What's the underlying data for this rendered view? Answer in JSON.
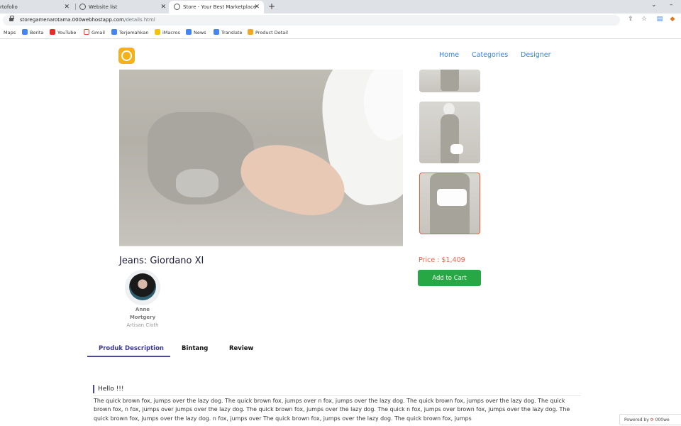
{
  "browser": {
    "tabs": [
      {
        "title": "rtofolio"
      },
      {
        "title": "Website list"
      },
      {
        "title": "Store - Your Best Marketplace"
      }
    ],
    "url_host": "storegamenarotama.000webhostapp.com",
    "url_path": "/details.html",
    "bookmarks": [
      "Maps",
      "Berita",
      "YouTube",
      "Gmail",
      "Terjemahkan",
      "iMacros",
      "News",
      "Translate",
      "Product Detail"
    ]
  },
  "header": {
    "nav": [
      "Home",
      "Categories",
      "Designer"
    ]
  },
  "product": {
    "title": "Jeans: Giordano XI",
    "price": "Price : $1,409",
    "add_to_cart": "Add to Cart",
    "designer_name_line1": "Anne",
    "designer_name_line2": "Mortgery",
    "designer_role": "Artisan Cloth"
  },
  "tabs": [
    "Produk Description",
    "Bintang",
    "Review"
  ],
  "description": {
    "heading": "Hello !!!",
    "body": "The quick brown fox, jumps over the lazy dog. The quick brown fox, jumps over n fox, jumps over the lazy dog. The quick brown fox, jumps over the lazy dog. The quick brown fox, n fox, jumps over jumps over the lazy dog. The quick brown fox, jumps over the lazy dog. The quick n fox, jumps over brown fox, jumps over the lazy dog. The quick brown fox, jumps over the lazy dog. n fox, jumps over The quick brown fox, jumps over the lazy dog. The quick brown fox, jumps"
  },
  "footer_badge": {
    "prefix": "Powered by",
    "brand": "000we"
  },
  "colors": {
    "accent": "#2f80ed",
    "price": "#f0624a",
    "cart": "#28a745",
    "tab_active": "#4a47a3",
    "logo": "#f6b01a"
  }
}
